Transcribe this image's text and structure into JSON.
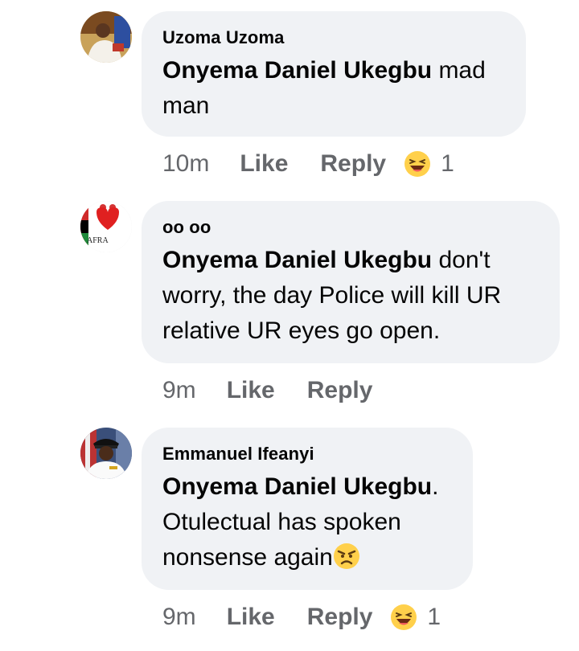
{
  "comments": [
    {
      "author": "Uzoma Uzoma",
      "mention": "Onyema Daniel Ukegbu",
      "text": " mad man",
      "time": "10m",
      "like_label": "Like",
      "reply_label": "Reply",
      "reaction_icon": "laughing-emoji-icon",
      "reaction_count": "1"
    },
    {
      "author": "oo oo",
      "mention": "Onyema Daniel Ukegbu",
      "text": " don't worry, the day Police will kill UR relative UR eyes go open.",
      "avatar_text": "AFRA",
      "time": "9m",
      "like_label": "Like",
      "reply_label": "Reply"
    },
    {
      "author": "Emmanuel Ifeanyi",
      "mention": "Onyema Daniel Ukegbu",
      "text": ". Otulectual has spoken nonsense again",
      "inline_emoji": "angry-face-emoji-icon",
      "time": "9m",
      "like_label": "Like",
      "reply_label": "Reply",
      "reaction_icon": "laughing-emoji-icon",
      "reaction_count": "1"
    }
  ],
  "colors": {
    "bubble": "#f0f2f5",
    "meta_text": "#65676b",
    "emoji_yellow": "#ffd04b"
  }
}
